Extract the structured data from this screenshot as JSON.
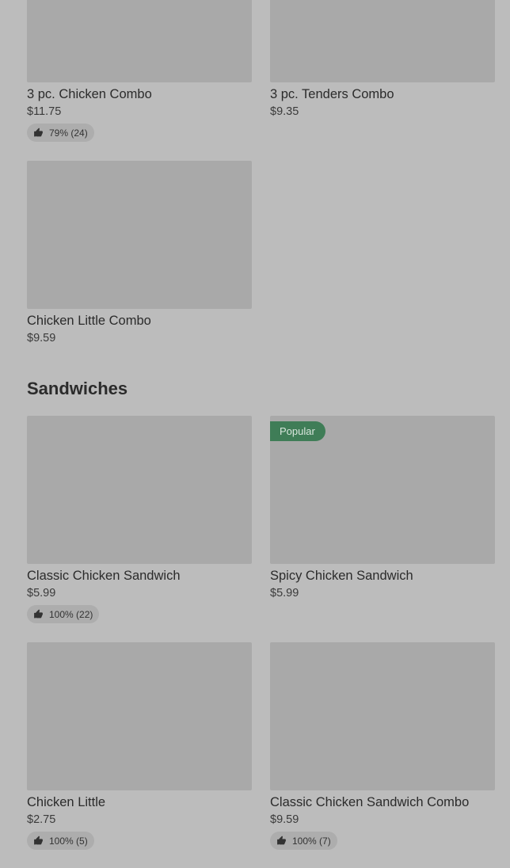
{
  "combos": [
    {
      "name": "3 pc. Chicken Combo",
      "price": "$11.75",
      "rating": "79% (24)"
    },
    {
      "name": "3 pc. Tenders Combo",
      "price": "$9.35"
    },
    {
      "name": "Chicken Little Combo",
      "price": "$9.59"
    }
  ],
  "sandwiches": {
    "title": "Sandwiches",
    "items": [
      {
        "name": "Classic Chicken Sandwich",
        "price": "$5.99",
        "rating": "100% (22)"
      },
      {
        "name": "Spicy Chicken Sandwich",
        "price": "$5.99",
        "badge": "Popular"
      },
      {
        "name": "Chicken Little",
        "price": "$2.75",
        "rating": "100% (5)"
      },
      {
        "name": "Classic Chicken Sandwich Combo",
        "price": "$9.59",
        "rating": "100% (7)"
      }
    ]
  },
  "icons": {
    "rating": "thumbs-up-icon"
  },
  "colors": {
    "badge": "#3f7d57",
    "background": "#bcbcbc",
    "image_placeholder": "#a9a9a9"
  }
}
